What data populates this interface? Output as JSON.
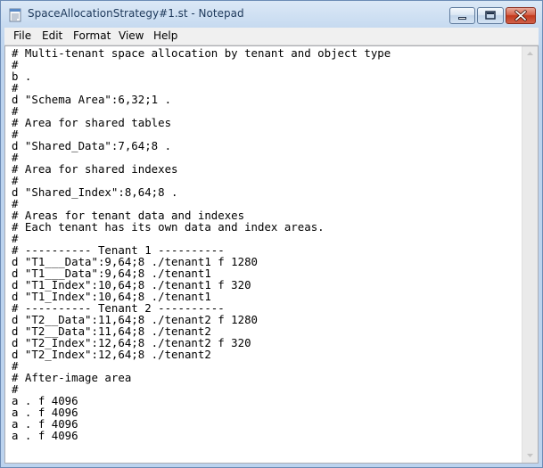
{
  "window": {
    "title": "SpaceAllocationStrategy#1.st - Notepad"
  },
  "menu": {
    "items": [
      "File",
      "Edit",
      "Format",
      "View",
      "Help"
    ]
  },
  "editor": {
    "lines": [
      "# Multi-tenant space allocation by tenant and object type",
      "#",
      "b .",
      "#",
      "d \"Schema Area\":6,32;1 .",
      "#",
      "# Area for shared tables",
      "#",
      "d \"Shared_Data\":7,64;8 .",
      "#",
      "# Area for shared indexes",
      "#",
      "d \"Shared_Index\":8,64;8 .",
      "#",
      "# Areas for tenant data and indexes",
      "# Each tenant has its own data and index areas.",
      "#",
      "# ---------- Tenant 1 ----------",
      "d \"T1___Data\":9,64;8 ./tenant1 f 1280",
      "d \"T1___Data\":9,64;8 ./tenant1",
      "d \"T1_Index\":10,64;8 ./tenant1 f 320",
      "d \"T1_Index\":10,64;8 ./tenant1",
      "# ---------- Tenant 2 ----------",
      "d \"T2__Data\":11,64;8 ./tenant2 f 1280",
      "d \"T2__Data\":11,64;8 ./tenant2",
      "d \"T2_Index\":12,64;8 ./tenant2 f 320",
      "d \"T2_Index\":12,64;8 ./tenant2",
      "#",
      "# After-image area",
      "#",
      "a . f 4096",
      "a . f 4096",
      "a . f 4096",
      "a . f 4096"
    ]
  },
  "icons": {
    "app": "notepad-icon",
    "minimize": "minimize-icon",
    "maximize": "maximize-icon",
    "close": "close-icon",
    "scroll_up": "scroll-up-arrow-icon",
    "scroll_down": "scroll-down-arrow-icon"
  }
}
